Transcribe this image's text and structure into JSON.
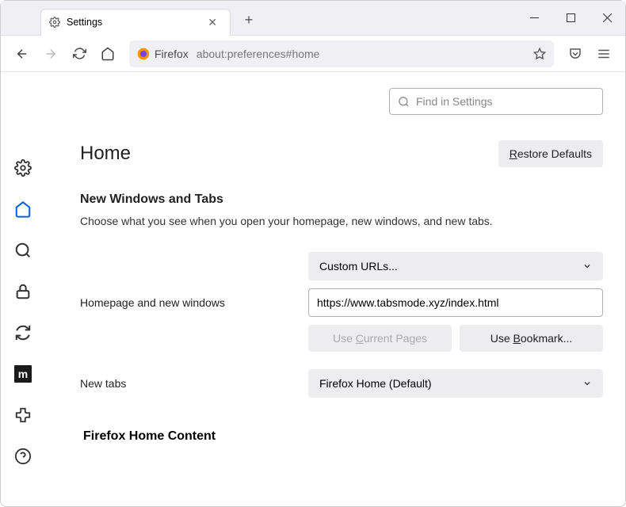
{
  "tab": {
    "title": "Settings"
  },
  "toolbar": {
    "fx_label": "Firefox",
    "url": "about:preferences#home"
  },
  "search": {
    "placeholder": "Find in Settings"
  },
  "page": {
    "title": "Home",
    "restore": "Restore Defaults",
    "section_title": "New Windows and Tabs",
    "section_desc": "Choose what you see when you open your homepage, new windows, and new tabs.",
    "homepage_label": "Homepage and new windows",
    "homepage_select": "Custom URLs...",
    "homepage_url": "https://www.tabsmode.xyz/index.html",
    "use_current": "Use Current Pages",
    "use_bookmark": "Use Bookmark...",
    "newtabs_label": "New tabs",
    "newtabs_select": "Firefox Home (Default)",
    "home_content": "Firefox Home Content"
  }
}
